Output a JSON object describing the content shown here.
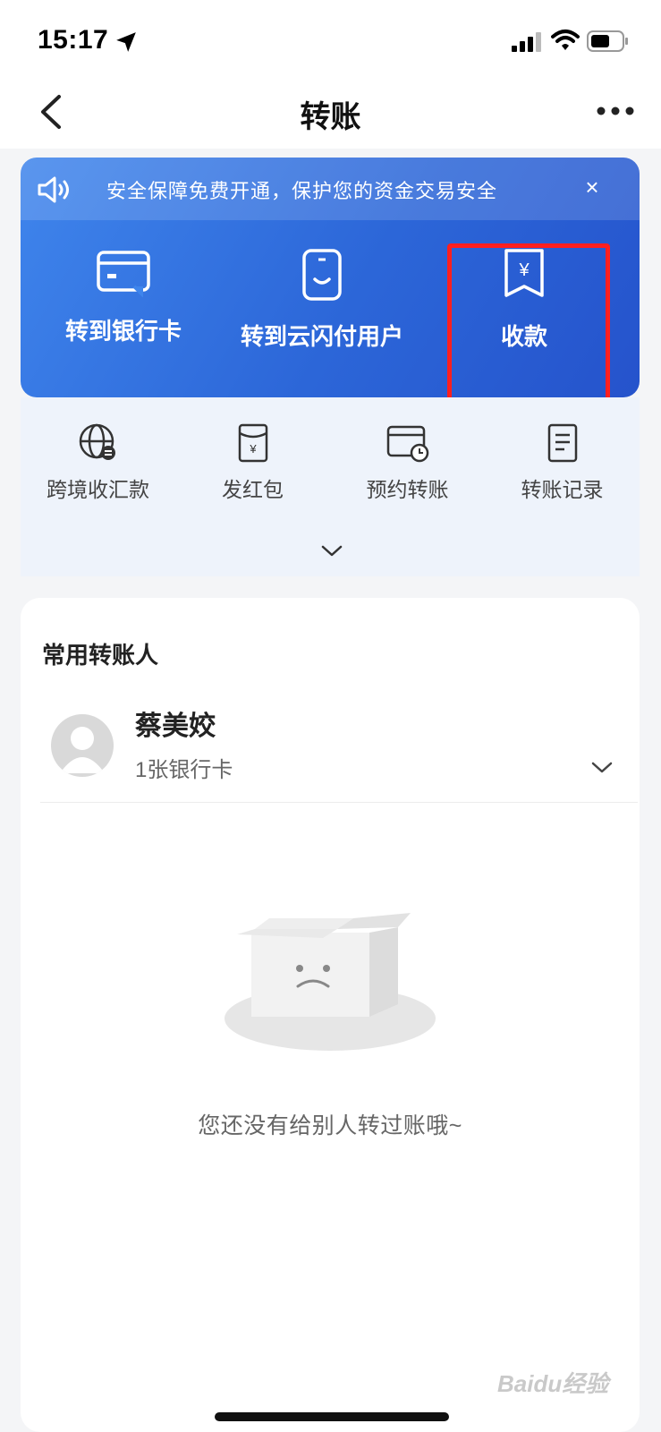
{
  "status_bar": {
    "time": "15:17"
  },
  "nav": {
    "title": "转账"
  },
  "notice": {
    "text": "安全保障免费开通，保护您的资金交易安全",
    "close": "×"
  },
  "actions": [
    {
      "label": "转到银行卡",
      "icon": "bank-card-icon"
    },
    {
      "label": "转到云闪付用户",
      "icon": "phone-user-icon"
    },
    {
      "label": "收款",
      "icon": "receive-money-icon"
    }
  ],
  "secondary": [
    {
      "label": "跨境收汇款",
      "icon": "globe-exchange-icon"
    },
    {
      "label": "发红包",
      "icon": "red-envelope-icon"
    },
    {
      "label": "预约转账",
      "icon": "scheduled-transfer-icon"
    },
    {
      "label": "转账记录",
      "icon": "transfer-record-icon"
    }
  ],
  "contacts": {
    "title": "常用转账人",
    "items": [
      {
        "name": "蔡美姣",
        "sub": "1张银行卡"
      }
    ]
  },
  "empty": {
    "text": "您还没有给别人转过账哦~"
  },
  "watermark": "Baidu经验",
  "colors": {
    "accent": "#2f6de0",
    "highlight": "#ff1f1f"
  }
}
